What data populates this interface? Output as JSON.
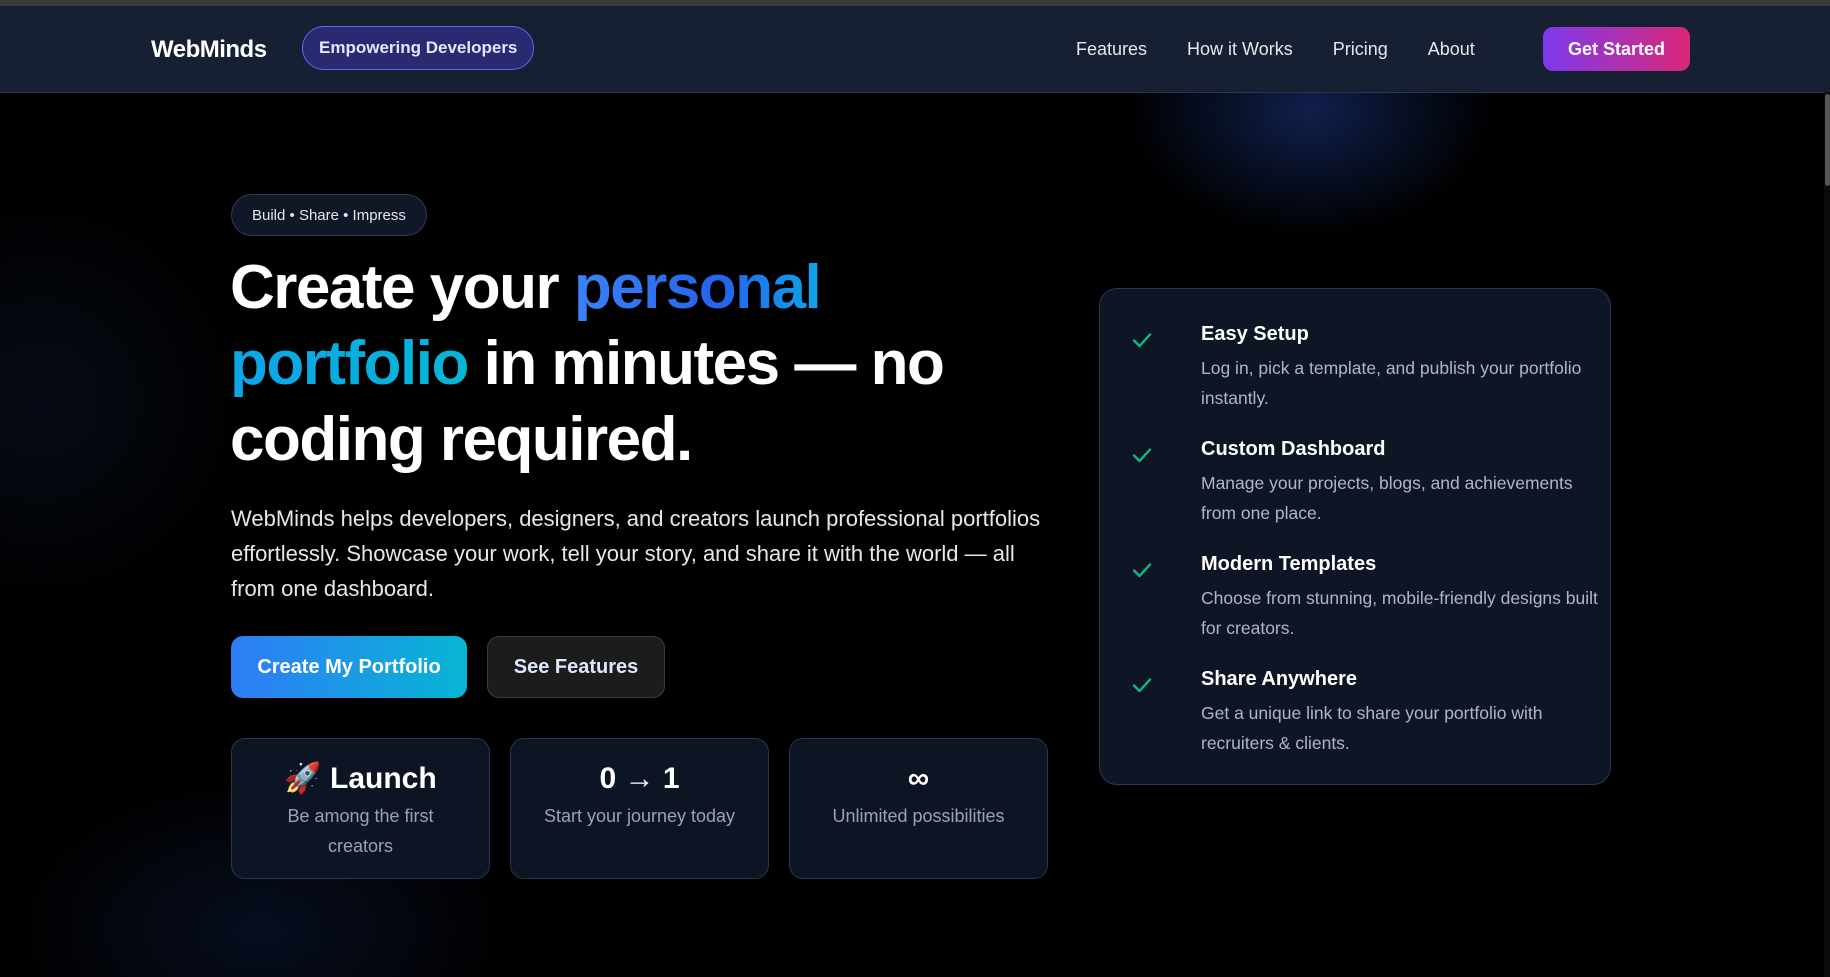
{
  "nav": {
    "brand": "WebMinds",
    "pill": "Empowering Developers",
    "links": [
      "Features",
      "How it Works",
      "Pricing",
      "About"
    ],
    "cta": "Get Started"
  },
  "hero": {
    "tagline": "Build • Share • Impress",
    "headline": {
      "part1": "Create your ",
      "accent1": "personal",
      "accent2": "portfolio",
      "part2": " in minutes — no coding required."
    },
    "lede": "WebMinds helps developers, designers, and creators launch professional portfolios effortlessly. Showcase your work, tell your story, and share it with the world — all from one dashboard.",
    "primary_button": "Create My Portfolio",
    "secondary_button": "See Features",
    "stats": [
      {
        "title": "🚀 Launch",
        "desc": "Be among the first creators"
      },
      {
        "title": "0 → 1",
        "desc": "Start your journey today"
      },
      {
        "title": "∞",
        "desc": "Unlimited possibilities"
      }
    ]
  },
  "features": [
    {
      "icon": "check-icon",
      "title": "Easy Setup",
      "desc": "Log in, pick a template, and publish your portfolio instantly."
    },
    {
      "icon": "check-icon",
      "title": "Custom Dashboard",
      "desc": "Manage your projects, blogs, and achievements from one place."
    },
    {
      "icon": "check-icon",
      "title": "Modern Templates",
      "desc": "Choose from stunning, mobile-friendly designs built for creators."
    },
    {
      "icon": "check-icon",
      "title": "Share Anywhere",
      "desc": "Get a unique link to share your portfolio with recruiters & clients."
    }
  ],
  "colors": {
    "accent_blue": "#2f7cf6",
    "accent_cyan": "#06b6d4",
    "cta_purple": "#7c3aed",
    "cta_pink": "#db2777",
    "check_green": "#10b981"
  }
}
